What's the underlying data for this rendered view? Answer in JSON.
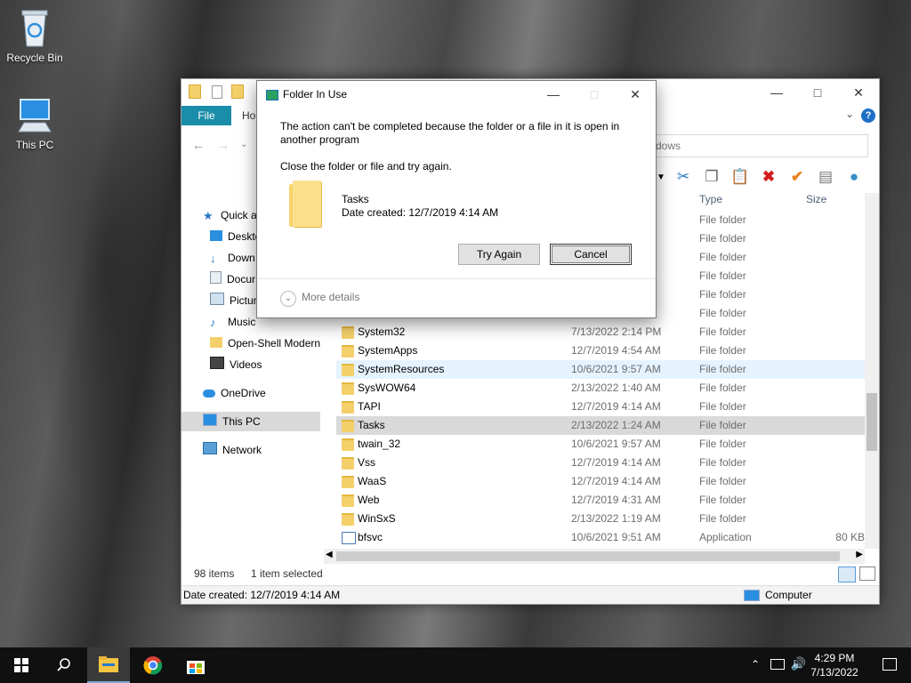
{
  "desktop": {
    "icons": [
      {
        "label": "Recycle Bin",
        "icon": "recycle-bin-icon"
      },
      {
        "label": "This PC",
        "icon": "computer-icon"
      }
    ]
  },
  "explorer": {
    "tabs": {
      "file": "File",
      "home": "Ho"
    },
    "address_text": "dows",
    "columns": {
      "type": "Type",
      "size": "Size"
    },
    "nav_items": [
      {
        "label": "Quick a",
        "icon": "star-icon"
      },
      {
        "label": "Deskto",
        "icon": "desktop-icon"
      },
      {
        "label": "Down",
        "icon": "download-icon"
      },
      {
        "label": "Docur",
        "icon": "documents-icon"
      },
      {
        "label": "Pictur",
        "icon": "pictures-icon"
      },
      {
        "label": "Music",
        "icon": "music-icon"
      },
      {
        "label": "Open-Shell Modern",
        "icon": "folder-icon"
      },
      {
        "label": "Videos",
        "icon": "videos-icon"
      },
      {
        "label": "OneDrive",
        "icon": "cloud-icon"
      },
      {
        "label": "This PC",
        "icon": "computer-icon"
      },
      {
        "label": "Network",
        "icon": "network-icon"
      }
    ],
    "hidden_rows_type": [
      "File folder",
      "File folder",
      "File folder",
      "File folder",
      "File folder",
      "File folder"
    ],
    "files": [
      {
        "name": "System32",
        "date": "7/13/2022 2:14 PM",
        "type": "File folder",
        "size": ""
      },
      {
        "name": "SystemApps",
        "date": "12/7/2019 4:54 AM",
        "type": "File folder",
        "size": ""
      },
      {
        "name": "SystemResources",
        "date": "10/6/2021 9:57 AM",
        "type": "File folder",
        "size": ""
      },
      {
        "name": "SysWOW64",
        "date": "2/13/2022 1:40 AM",
        "type": "File folder",
        "size": ""
      },
      {
        "name": "TAPI",
        "date": "12/7/2019 4:14 AM",
        "type": "File folder",
        "size": ""
      },
      {
        "name": "Tasks",
        "date": "2/13/2022 1:24 AM",
        "type": "File folder",
        "size": ""
      },
      {
        "name": "twain_32",
        "date": "10/6/2021 9:57 AM",
        "type": "File folder",
        "size": ""
      },
      {
        "name": "Vss",
        "date": "12/7/2019 4:14 AM",
        "type": "File folder",
        "size": ""
      },
      {
        "name": "WaaS",
        "date": "12/7/2019 4:14 AM",
        "type": "File folder",
        "size": ""
      },
      {
        "name": "Web",
        "date": "12/7/2019 4:31 AM",
        "type": "File folder",
        "size": ""
      },
      {
        "name": "WinSxS",
        "date": "2/13/2022 1:19 AM",
        "type": "File folder",
        "size": ""
      },
      {
        "name": "bfsvc",
        "date": "10/6/2021 9:51 AM",
        "type": "Application",
        "size": "80 KB"
      }
    ],
    "status": {
      "count": "98 items",
      "selected": "1 item selected"
    },
    "details": {
      "date_created": "Date created: 12/7/2019 4:14 AM",
      "location": "Computer"
    }
  },
  "dialog": {
    "title": "Folder In Use",
    "message_line1": "The action can't be completed because the folder or a file in it is open in",
    "message_line2": "another program",
    "instruction": "Close the folder or file and try again.",
    "item_name": "Tasks",
    "item_date": "Date created: 12/7/2019 4:14 AM",
    "try_again": "Try Again",
    "cancel": "Cancel",
    "more_details": "More details"
  },
  "taskbar": {
    "time": "4:29 PM",
    "date": "7/13/2022",
    "apps": [
      "start-icon",
      "search-icon",
      "file-explorer-icon",
      "chrome-icon",
      "store-icon"
    ]
  }
}
